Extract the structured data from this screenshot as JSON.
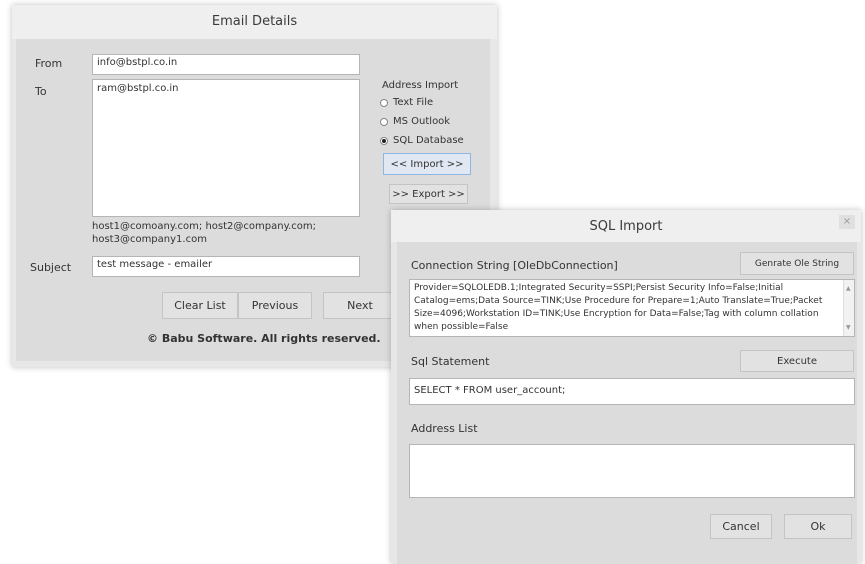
{
  "email_window": {
    "title": "Email Details",
    "from_label": "From",
    "from_value": "info@bstpl.co.in",
    "to_label": "To",
    "to_value": "ram@bstpl.co.in",
    "hint_line1": "host1@comoany.com; host2@company.com;",
    "hint_line2": "host3@company1.com",
    "subject_label": "Subject",
    "subject_value": "test message - emailer",
    "address_import_label": "Address Import",
    "options": [
      "Text File",
      "MS Outlook",
      "SQL Database"
    ],
    "selected_option": "SQL Database",
    "import_button": "<< Import >>",
    "export_button": ">> Export >>",
    "clear_button": "Clear List",
    "previous_button": "Previous",
    "next_button": "Next",
    "copyright": "© Babu Software. All rights reserved."
  },
  "sql_window": {
    "title": "SQL Import",
    "close_glyph": "×",
    "conn_label": "Connection String  [OleDbConnection]",
    "generate_button": "Genrate Ole String",
    "conn_value": "Provider=SQLOLEDB.1;Integrated Security=SSPI;Persist Security Info=False;Initial Catalog=ems;Data Source=TINK;Use Procedure for Prepare=1;Auto Translate=True;Packet Size=4096;Workstation ID=TINK;Use Encryption for Data=False;Tag with column collation when possible=False",
    "sql_label": "Sql Statement",
    "execute_button": "Execute",
    "sql_value": "SELECT * FROM user_account;",
    "address_list_label": "Address List",
    "cancel_button": "Cancel",
    "ok_button": "Ok"
  }
}
